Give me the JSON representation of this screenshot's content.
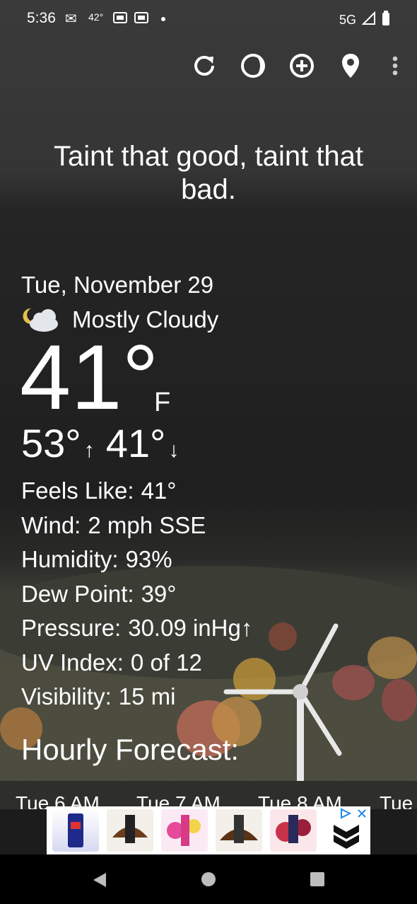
{
  "status_bar": {
    "time": "5:36",
    "temp_indicator": "42°",
    "network": "5G",
    "icons": [
      "gmail-icon",
      "news-icon",
      "news-icon",
      "dot-icon",
      "signal-icon",
      "battery-icon"
    ]
  },
  "toolbar": {
    "icons": [
      "refresh-icon",
      "theme-icon",
      "add-location-icon",
      "location-pin-icon",
      "more-vert-icon"
    ]
  },
  "quote": "Taint that good, taint that bad.",
  "current": {
    "date": "Tue, November 29",
    "condition": "Mostly Cloudy",
    "condition_icon": "partly-cloudy-night-icon",
    "temp": "41°",
    "unit": "F",
    "high": "53°",
    "low": "41°",
    "high_arrow": "↑",
    "low_arrow": "↓"
  },
  "details": [
    {
      "label": "Feels Like:",
      "value": "41°"
    },
    {
      "label": "Wind:",
      "value": "2 mph SSE"
    },
    {
      "label": "Humidity:",
      "value": "93%"
    },
    {
      "label": "Dew Point:",
      "value": "39°"
    },
    {
      "label": "Pressure:",
      "value": "30.09 inHg↑"
    },
    {
      "label": "UV Index:",
      "value": "0 of 12"
    },
    {
      "label": "Visibility:",
      "value": "15 mi"
    }
  ],
  "hourly": {
    "title": "Hourly Forecast:",
    "hours": [
      "Tue 6 AM",
      "Tue 7 AM",
      "Tue 8 AM",
      "Tue"
    ]
  },
  "ad": {
    "icons": [
      "adchoices-icon",
      "close-icon",
      "brand-logo-icon"
    ]
  },
  "nav": {
    "icons": [
      "back-icon",
      "home-icon",
      "recents-icon"
    ]
  },
  "colors": {
    "background": "#1c1c1c",
    "text": "#ffffff"
  }
}
